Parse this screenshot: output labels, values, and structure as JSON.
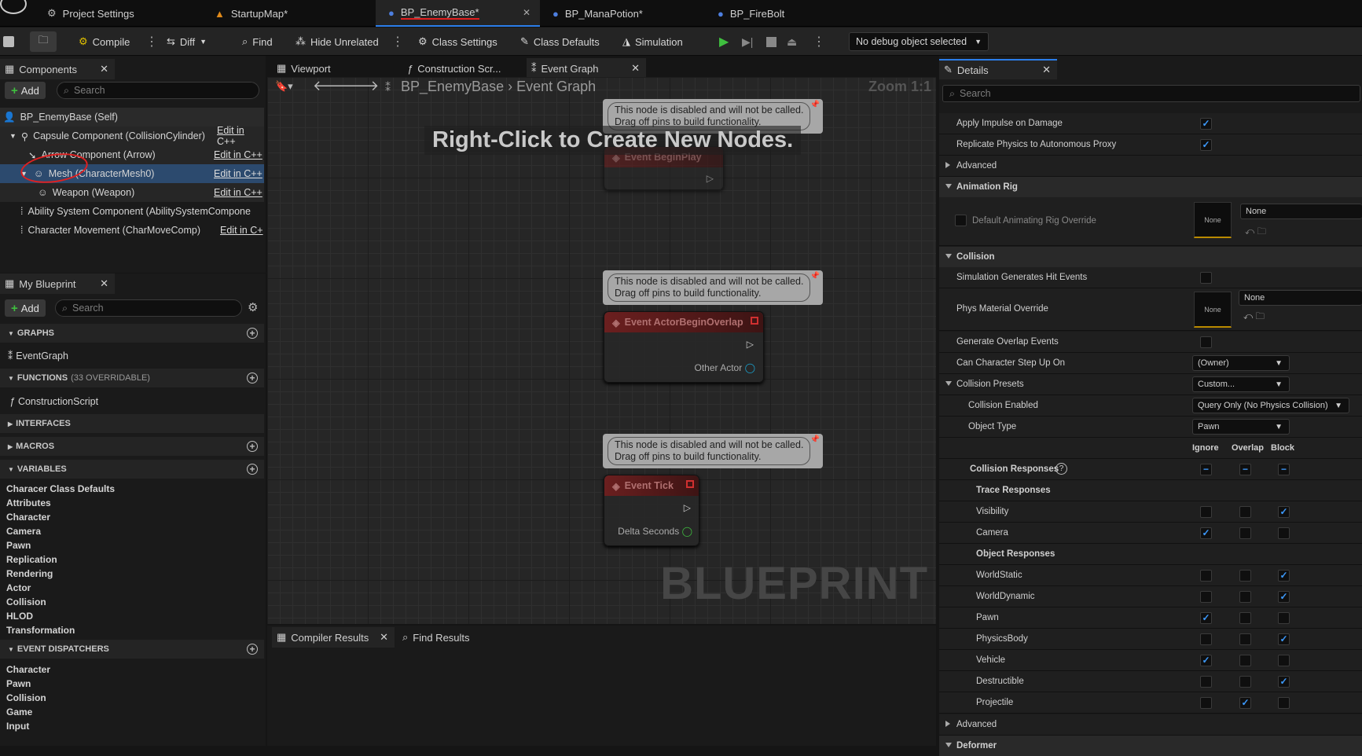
{
  "doc_tabs": [
    {
      "label": "Project Settings",
      "icon": "settings-icon"
    },
    {
      "label": "StartupMap*",
      "icon": "map-icon"
    },
    {
      "label": "BP_EnemyBase*",
      "icon": "blueprint-icon",
      "active": true
    },
    {
      "label": "BP_ManaPotion*",
      "icon": "blueprint-icon"
    },
    {
      "label": "BP_FireBolt",
      "icon": "blueprint-icon"
    }
  ],
  "toolbar": {
    "compile": "Compile",
    "diff": "Diff",
    "find": "Find",
    "hide_unrelated": "Hide Unrelated",
    "class_settings": "Class Settings",
    "class_defaults": "Class Defaults",
    "simulation": "Simulation",
    "debug_object": "No debug object selected"
  },
  "components": {
    "tab": "Components",
    "add": "Add",
    "search_placeholder": "Search",
    "items": [
      {
        "label": "BP_EnemyBase (Self)",
        "edit": ""
      },
      {
        "label": "Capsule Component (CollisionCylinder)",
        "edit": "Edit in C++"
      },
      {
        "label": "Arrow Component (Arrow)",
        "edit": "Edit in C++"
      },
      {
        "label": "Mesh (CharacterMesh0)",
        "edit": "Edit in C++"
      },
      {
        "label": "Weapon (Weapon)",
        "edit": "Edit in C++"
      },
      {
        "label": "Ability System Component (AbilitySystemCompone",
        "edit": ""
      },
      {
        "label": "Character Movement (CharMoveComp)",
        "edit": "Edit in C+"
      }
    ]
  },
  "my_blueprint": {
    "tab": "My Blueprint",
    "add": "Add",
    "search_placeholder": "Search",
    "graphs_header": "GRAPHS",
    "event_graph": "EventGraph",
    "functions_header": "FUNCTIONS",
    "functions_count": "(33 OVERRIDABLE)",
    "construction_script": "ConstructionScript",
    "interfaces_header": "INTERFACES",
    "macros_header": "MACROS",
    "variables_header": "VARIABLES",
    "variables": [
      "Characer Class Defaults",
      "Attributes",
      "Character",
      "Camera",
      "Pawn",
      "Replication",
      "Rendering",
      "Actor",
      "Collision",
      "HLOD",
      "Transformation"
    ],
    "dispatchers_header": "EVENT DISPATCHERS",
    "dispatchers": [
      "Character",
      "Pawn",
      "Collision",
      "Game",
      "Input"
    ]
  },
  "graph_tabs": {
    "viewport": "Viewport",
    "construction": "Construction Scr...",
    "event_graph": "Event Graph"
  },
  "graph": {
    "breadcrumb_root": "BP_EnemyBase",
    "breadcrumb_leaf": "Event Graph",
    "zoom": "Zoom 1:1",
    "hint": "Right-Click to Create New Nodes.",
    "watermark": "BLUEPRINT",
    "disabled_line1": "This node is disabled and will not be called.",
    "disabled_line2": "Drag off pins to build functionality.",
    "node1": "Event BeginPlay",
    "node2": "Event ActorBeginOverlap",
    "node2_pin": "Other Actor",
    "node3": "Event Tick",
    "node3_pin": "Delta Seconds"
  },
  "bottom_tabs": {
    "compiler": "Compiler Results",
    "find": "Find Results"
  },
  "details": {
    "tab": "Details",
    "search_placeholder": "Search",
    "apply_impulse": "Apply Impulse on Damage",
    "replicate_physics": "Replicate Physics to Autonomous Proxy",
    "advanced": "Advanced",
    "animation_rig": "Animation Rig",
    "default_rig": "Default Animating Rig Override",
    "none": "None",
    "collision": "Collision",
    "sim_hit": "Simulation Generates Hit Events",
    "phys_mat": "Phys Material Override",
    "gen_overlap": "Generate Overlap Events",
    "step_up": "Can Character Step Up On",
    "step_up_value": "(Owner)",
    "presets": "Collision Presets",
    "presets_value": "Custom...",
    "collision_enabled": "Collision Enabled",
    "collision_enabled_value": "Query Only (No Physics Collision)",
    "object_type": "Object Type",
    "object_type_value": "Pawn",
    "col_ignore": "Ignore",
    "col_overlap": "Overlap",
    "col_block": "Block",
    "responses": "Collision Responses",
    "trace_responses": "Trace Responses",
    "object_responses": "Object Responses",
    "trace_rows": [
      {
        "label": "Visibility",
        "checked": [
          false,
          false,
          true
        ]
      },
      {
        "label": "Camera",
        "checked": [
          true,
          false,
          false
        ]
      }
    ],
    "object_rows": [
      {
        "label": "WorldStatic",
        "checked": [
          false,
          false,
          true
        ]
      },
      {
        "label": "WorldDynamic",
        "checked": [
          false,
          false,
          true
        ]
      },
      {
        "label": "Pawn",
        "checked": [
          true,
          false,
          false
        ]
      },
      {
        "label": "PhysicsBody",
        "checked": [
          false,
          false,
          true
        ]
      },
      {
        "label": "Vehicle",
        "checked": [
          true,
          false,
          false
        ]
      },
      {
        "label": "Destructible",
        "checked": [
          false,
          false,
          true
        ]
      },
      {
        "label": "Projectile",
        "checked": [
          false,
          true,
          false
        ]
      }
    ],
    "advanced2": "Advanced",
    "deformer": "Deformer"
  },
  "colors": {
    "accent": "#2b7de9",
    "checkbox_check": "#3d9bff",
    "annotation": "#e02020"
  }
}
